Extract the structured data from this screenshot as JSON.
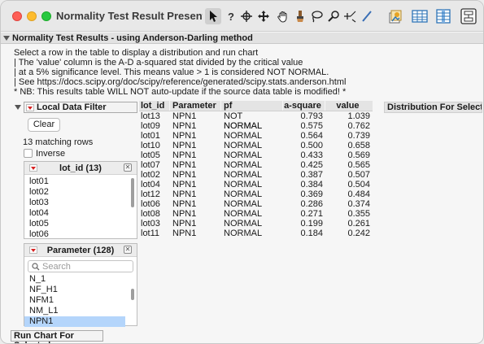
{
  "window": {
    "title": "Normality Test Result Presenta..."
  },
  "toolbar": {
    "tools": [
      "arrow-tool",
      "help-tool",
      "crosshair-tool",
      "move-tool",
      "grabber-tool",
      "brush-tool",
      "lasso-tool",
      "magnifier-tool",
      "annotate-tool",
      "line-tool"
    ],
    "right_icons": [
      "journal-icon",
      "data-table-icon",
      "column-icon",
      "layout-icon"
    ]
  },
  "report": {
    "title": "Normality Test Results - using Anderson-Darling method",
    "notes": [
      "Select a row in the table to display a distribution and run chart",
      "| The 'value' column is the A-D a-squared stat divided by the critical value",
      "|  at a 5% significance level. This means value > 1 is considered NOT NORMAL.",
      "|  See https://docs.scipy.org/doc/scipy/reference/generated/scipy.stats.anderson.html",
      "* NB: This results table WILL NOT auto-update if the source data table is modified! *"
    ]
  },
  "filter": {
    "title": "Local Data Filter",
    "clear_label": "Clear",
    "matching_text": "13 matching rows",
    "inverse_label": "Inverse",
    "inverse_checked": false,
    "lot_panel": {
      "title": "lot_id (13)",
      "items": [
        "lot01",
        "lot02",
        "lot03",
        "lot04",
        "lot05",
        "lot06"
      ]
    },
    "param_panel": {
      "title": "Parameter (128)",
      "search_placeholder": "Search",
      "items": [
        "N_1",
        "NF_H1",
        "NFM1",
        "NM_L1",
        "NPN1"
      ],
      "selected": "NPN1"
    },
    "run_chart_label": "Run Chart For Selected"
  },
  "results_table": {
    "columns": [
      "lot_id",
      "Parameter",
      "pf",
      "a-square",
      "value"
    ],
    "rows": [
      [
        "lot13",
        "NPN1",
        "NOT NORMAL",
        "0.793",
        "1.039"
      ],
      [
        "lot09",
        "NPN1",
        "NORMAL",
        "0.575",
        "0.762"
      ],
      [
        "lot01",
        "NPN1",
        "NORMAL",
        "0.564",
        "0.739"
      ],
      [
        "lot10",
        "NPN1",
        "NORMAL",
        "0.500",
        "0.658"
      ],
      [
        "lot05",
        "NPN1",
        "NORMAL",
        "0.433",
        "0.569"
      ],
      [
        "lot07",
        "NPN1",
        "NORMAL",
        "0.425",
        "0.565"
      ],
      [
        "lot02",
        "NPN1",
        "NORMAL",
        "0.387",
        "0.507"
      ],
      [
        "lot04",
        "NPN1",
        "NORMAL",
        "0.384",
        "0.504"
      ],
      [
        "lot12",
        "NPN1",
        "NORMAL",
        "0.369",
        "0.484"
      ],
      [
        "lot06",
        "NPN1",
        "NORMAL",
        "0.286",
        "0.374"
      ],
      [
        "lot08",
        "NPN1",
        "NORMAL",
        "0.271",
        "0.355"
      ],
      [
        "lot03",
        "NPN1",
        "NORMAL",
        "0.199",
        "0.261"
      ],
      [
        "lot11",
        "NPN1",
        "NORMAL",
        "0.184",
        "0.242"
      ]
    ]
  },
  "distribution_panel": {
    "title": "Distribution For Selected"
  },
  "colors": {
    "selected_row": "#b4d5fb",
    "red_triangle": "#d62222",
    "close": "#fe5f57",
    "minimize": "#febc2e",
    "maximize": "#28c840"
  }
}
